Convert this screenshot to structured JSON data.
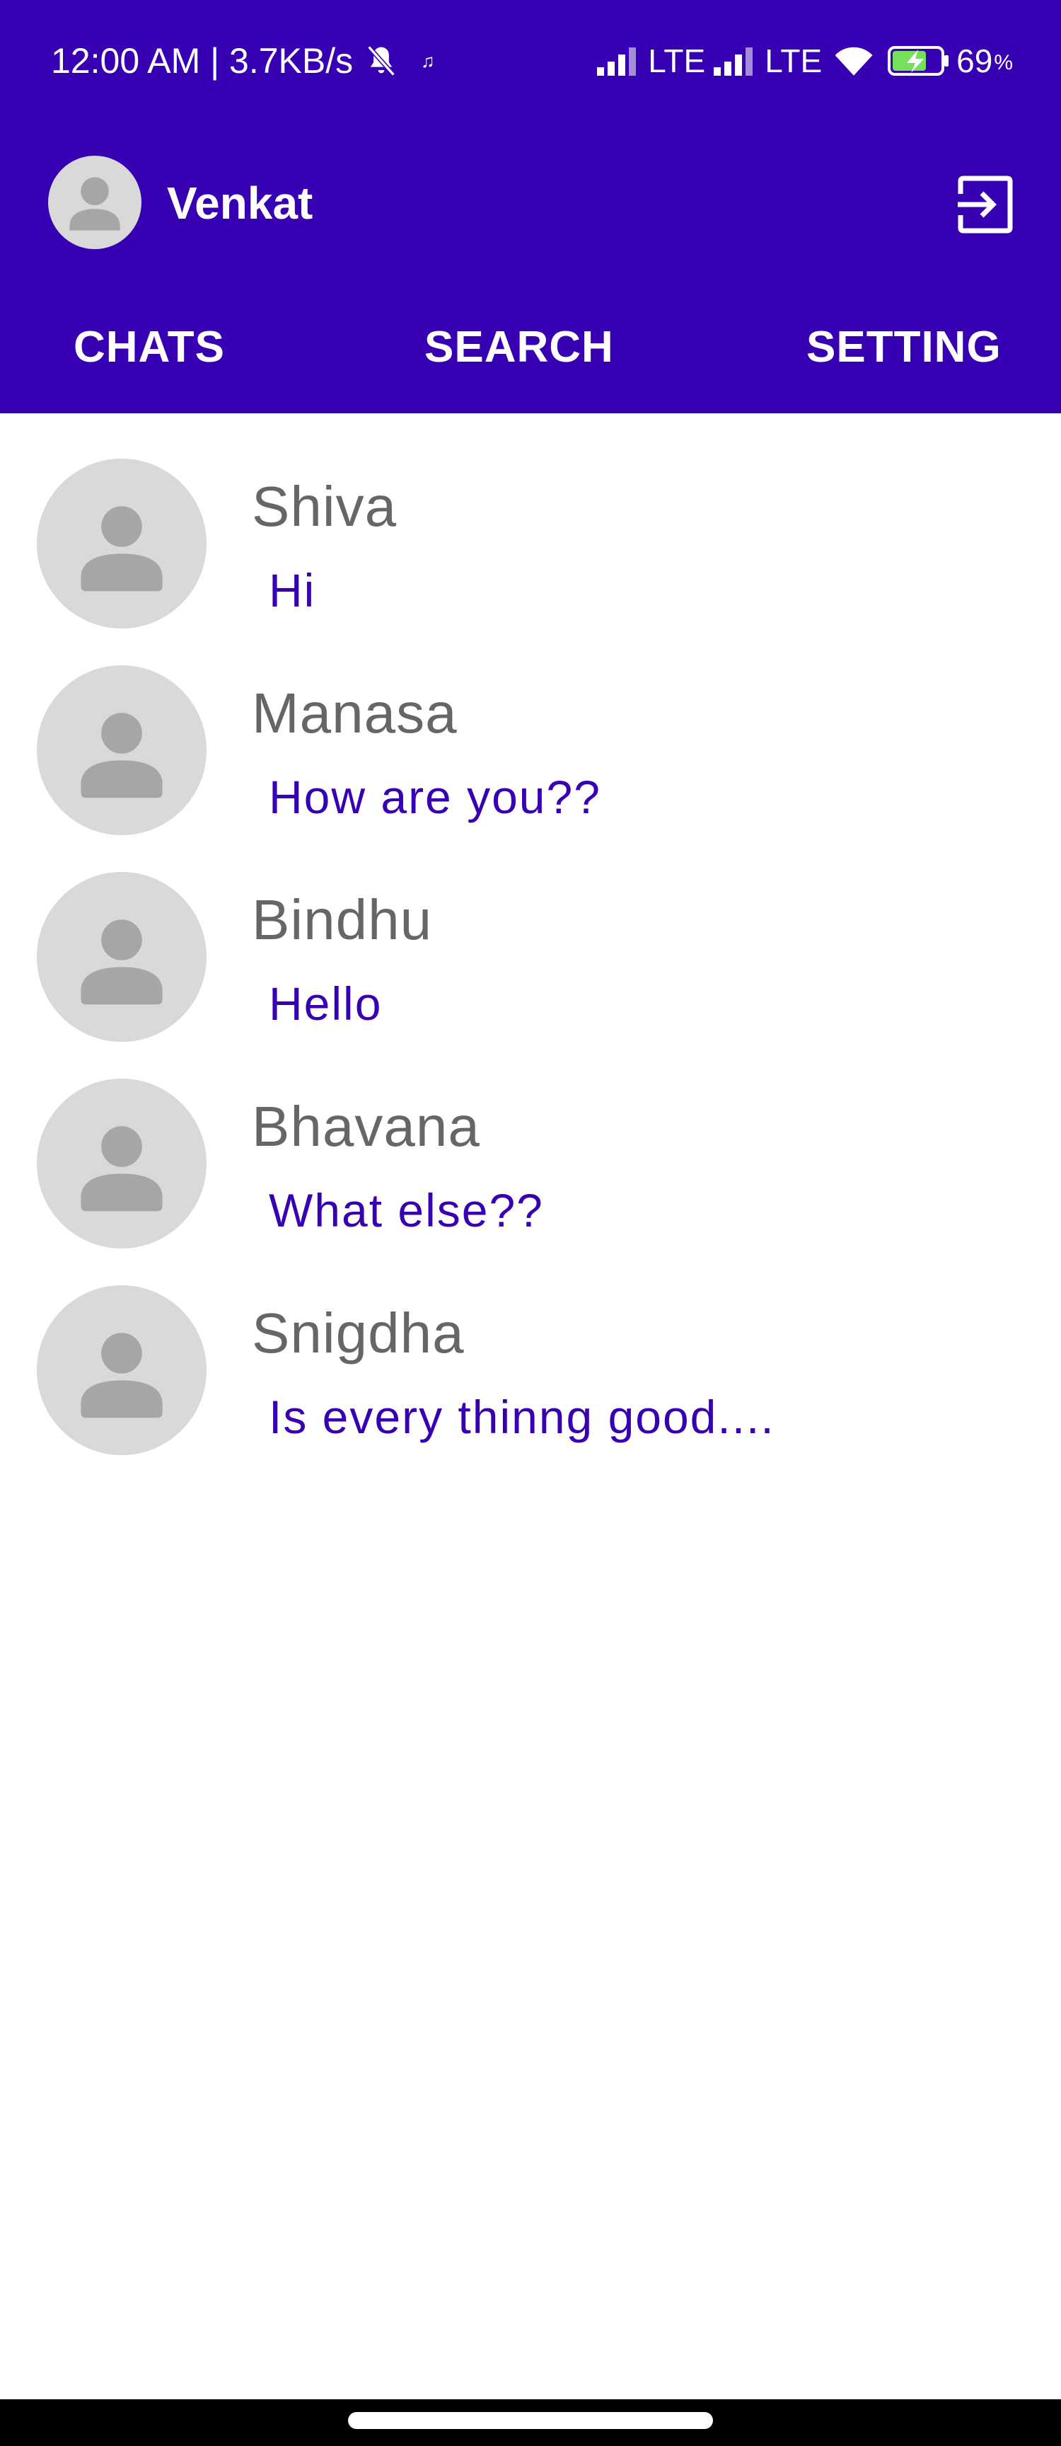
{
  "status_bar": {
    "time_speed": "12:00 AM | 3.7KB/s",
    "music_glyph": "♫",
    "lte_1": "LTE",
    "lte_2": "LTE",
    "battery_percent": "69",
    "battery_unit": "%",
    "icons": [
      "mute-icon",
      "music-icon",
      "signal-icon",
      "wifi-icon",
      "battery-charging-icon"
    ]
  },
  "app_bar": {
    "user_name": "Venkat",
    "background_color": "#3700b3",
    "icons": [
      "avatar-icon",
      "logout-icon"
    ]
  },
  "tabs": [
    {
      "label": "CHATS"
    },
    {
      "label": "SEARCH"
    },
    {
      "label": "SETTING"
    }
  ],
  "chats": [
    {
      "name": "Shiva",
      "last_message": "Hi"
    },
    {
      "name": "Manasa",
      "last_message": "How are you??"
    },
    {
      "name": "Bindhu",
      "last_message": "Hello"
    },
    {
      "name": "Bhavana",
      "last_message": "What else??"
    },
    {
      "name": "Snigdha",
      "last_message": "Is every thinng good...."
    }
  ],
  "colors": {
    "accent": "#3700b3",
    "avatar_bg": "#d9d9d9",
    "avatar_figure": "#a6a6a6",
    "name_text": "#666666"
  }
}
